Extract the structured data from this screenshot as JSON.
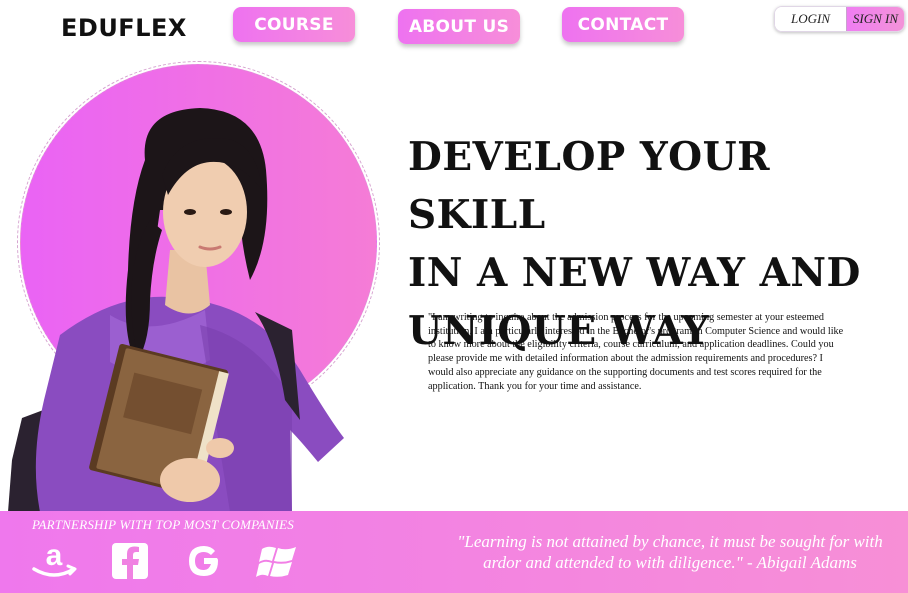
{
  "header": {
    "logo": "EDUFLEX",
    "nav": {
      "course": "COURSE",
      "about": "ABOUT US",
      "contact": "CONTACT"
    },
    "auth": {
      "login": "LOGIN",
      "signin": "SIGN IN"
    }
  },
  "hero": {
    "headline": "DEVELOP YOUR  SKILL\nIN A NEW WAY AND\nUNIQUE WAY",
    "paragraph": "\"I am writing to inquire about the admission process for the upcoming semester at your esteemed institution. I am particularly interested in the Bachelor's program in Computer Science and would like to know more about the eligibility criteria, course curriculum, and application deadlines. Could you please provide me with detailed information about the admission requirements and procedures? I would also appreciate any guidance on the supporting documents and test scores required for the application. Thank you for your time and assistance.",
    "image": "student-with-book"
  },
  "footer": {
    "partnership_title": "PARTNERSHIP WITH TOP MOST COMPANIES",
    "partners": [
      "amazon-icon",
      "facebook-icon",
      "google-icon",
      "windows-icon"
    ],
    "quote": "\"Learning is not attained by chance, it must be sought for with ardor and attended to with diligence.\" - Abigail Adams"
  },
  "colors": {
    "accent_pink": "#f07ae8",
    "accent_violet": "#e964f4",
    "text": "#111111",
    "white": "#ffffff"
  }
}
